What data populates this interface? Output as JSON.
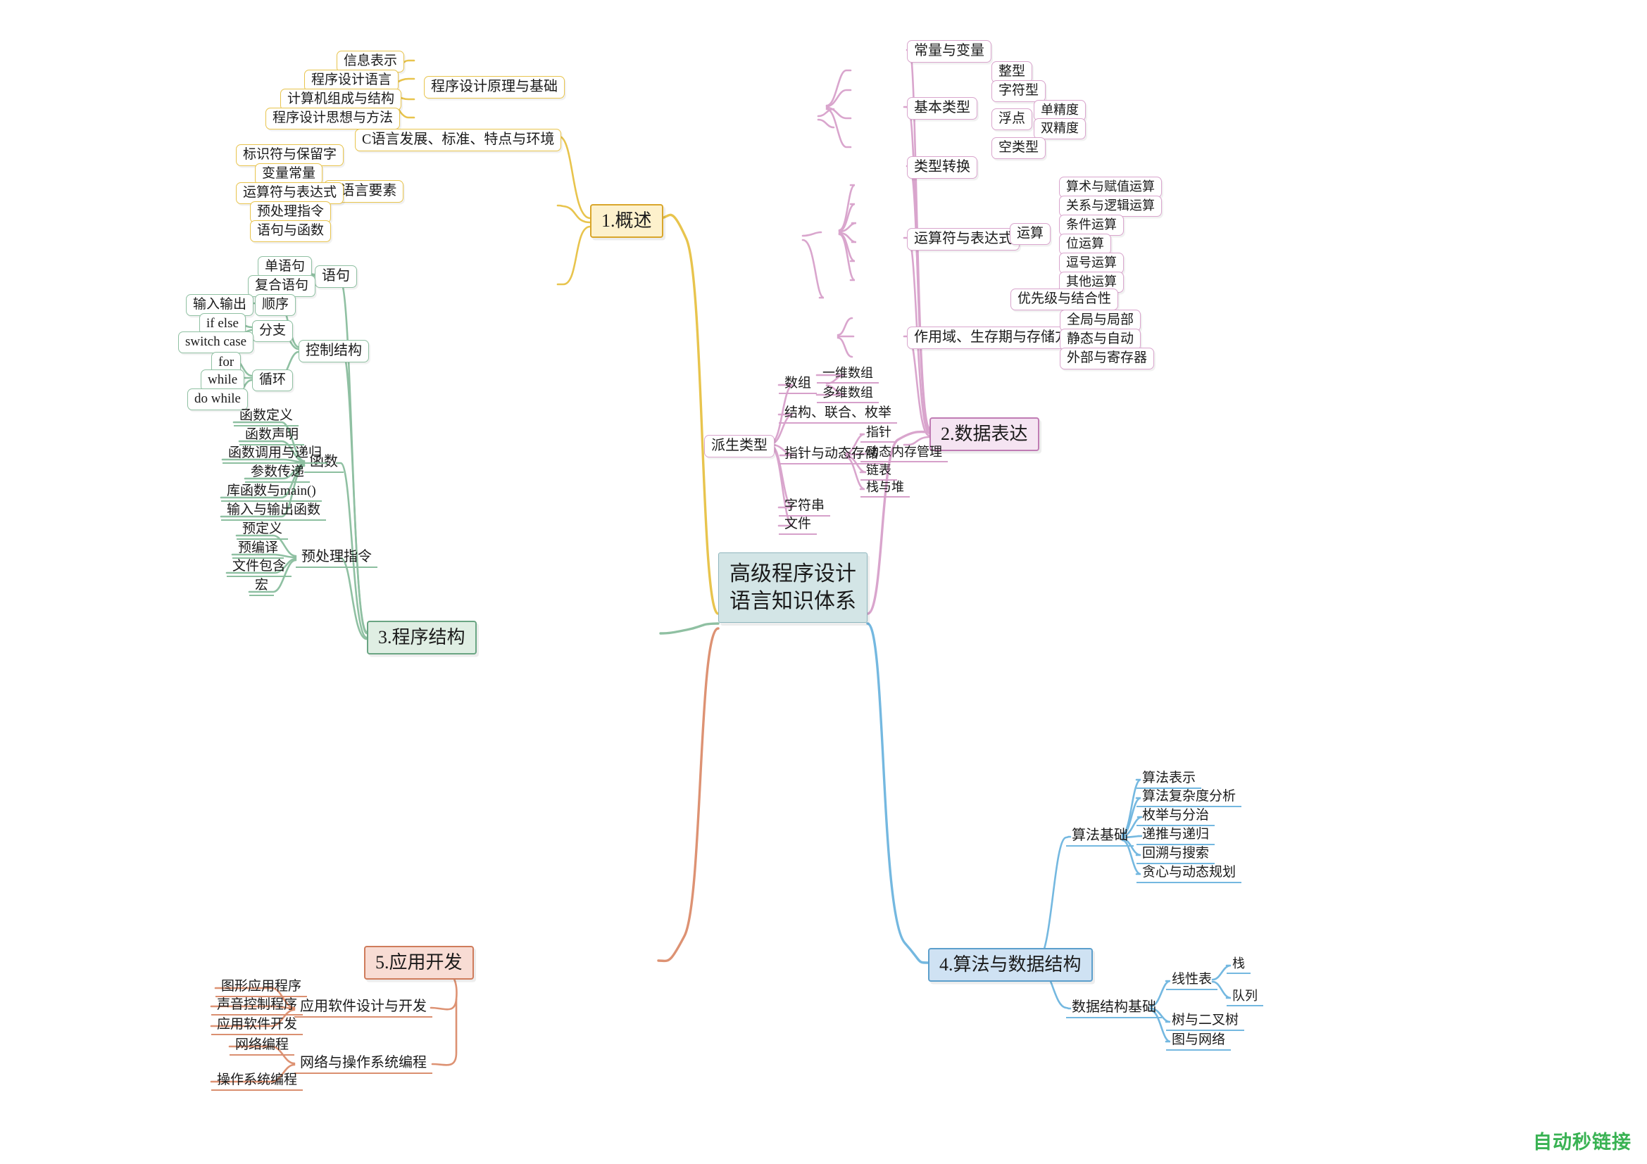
{
  "diagram": {
    "type": "mindmap",
    "root": {
      "label": "高级程序设计语言知识体系",
      "line1": "高级程序设计",
      "line2": "语言知识体系",
      "color": "#d3e5e6"
    },
    "watermark": "自动秒链接",
    "branches": [
      {
        "id": "overview",
        "label": "1.概述",
        "color": "#e8c44d",
        "children": [
          {
            "label": "程序设计原理与基础",
            "children": [
              {
                "label": "信息表示"
              },
              {
                "label": "程序设计语言"
              },
              {
                "label": "计算机组成与结构"
              },
              {
                "label": "程序设计思想与方法"
              }
            ]
          },
          {
            "label": "C语言发展、标准、特点与环境",
            "children": []
          },
          {
            "label": "C语言要素",
            "children": [
              {
                "label": "标识符与保留字"
              },
              {
                "label": "变量常量"
              },
              {
                "label": "运算符与表达式"
              },
              {
                "label": "预处理指令"
              },
              {
                "label": "语句与函数"
              }
            ]
          }
        ]
      },
      {
        "id": "data-expression",
        "label": "2.数据表达",
        "color": "#d9a5cd",
        "children": [
          {
            "label": "常量与变量",
            "children": []
          },
          {
            "label": "基本类型",
            "children": [
              {
                "label": "整型"
              },
              {
                "label": "字符型"
              },
              {
                "label": "浮点",
                "children": [
                  {
                    "label": "单精度"
                  },
                  {
                    "label": "双精度"
                  }
                ]
              },
              {
                "label": "空类型"
              }
            ]
          },
          {
            "label": "类型转换",
            "children": []
          },
          {
            "label": "运算符与表达式",
            "children": [
              {
                "label": "运算",
                "children": [
                  {
                    "label": "算术与赋值运算"
                  },
                  {
                    "label": "关系与逻辑运算"
                  },
                  {
                    "label": "条件运算"
                  },
                  {
                    "label": "位运算"
                  },
                  {
                    "label": "逗号运算"
                  },
                  {
                    "label": "其他运算"
                  }
                ]
              },
              {
                "label": "优先级与结合性"
              }
            ]
          },
          {
            "label": "作用域、生存期与存储方式",
            "children": [
              {
                "label": "全局与局部"
              },
              {
                "label": "静态与自动"
              },
              {
                "label": "外部与寄存器"
              }
            ]
          },
          {
            "label": "派生类型",
            "children": [
              {
                "label": "数组",
                "children": [
                  {
                    "label": "一维数组"
                  },
                  {
                    "label": "多维数组"
                  }
                ]
              },
              {
                "label": "结构、联合、枚举"
              },
              {
                "label": "指针与动态存储",
                "children": [
                  {
                    "label": "指针"
                  },
                  {
                    "label": "动态内存管理"
                  },
                  {
                    "label": "链表"
                  },
                  {
                    "label": "栈与堆"
                  }
                ]
              },
              {
                "label": "字符串"
              },
              {
                "label": "文件"
              }
            ]
          }
        ]
      },
      {
        "id": "program-structure",
        "label": "3.程序结构",
        "color": "#8fc0a2",
        "children": [
          {
            "label": "语句",
            "children": [
              {
                "label": "单语句"
              },
              {
                "label": "复合语句"
              }
            ]
          },
          {
            "label": "控制结构",
            "children": [
              {
                "label": "顺序",
                "children": [
                  {
                    "label": "输入输出"
                  }
                ]
              },
              {
                "label": "分支",
                "children": [
                  {
                    "label": "if else"
                  },
                  {
                    "label": "switch case"
                  }
                ]
              },
              {
                "label": "循环",
                "children": [
                  {
                    "label": "for"
                  },
                  {
                    "label": "while"
                  },
                  {
                    "label": "do while"
                  }
                ]
              }
            ]
          },
          {
            "label": "函数",
            "children": [
              {
                "label": "函数定义"
              },
              {
                "label": "函数声明"
              },
              {
                "label": "函数调用与递归"
              },
              {
                "label": "参数传递"
              },
              {
                "label": "库函数与main()"
              },
              {
                "label": "输入与输出函数"
              }
            ]
          },
          {
            "label": "预处理指令",
            "children": [
              {
                "label": "预定义"
              },
              {
                "label": "预编译"
              },
              {
                "label": "文件包含"
              },
              {
                "label": "宏"
              }
            ]
          }
        ]
      },
      {
        "id": "algorithms",
        "label": "4.算法与数据结构",
        "color": "#74b8e0",
        "children": [
          {
            "label": "算法基础",
            "children": [
              {
                "label": "算法表示"
              },
              {
                "label": "算法复杂度分析"
              },
              {
                "label": "枚举与分治"
              },
              {
                "label": "递推与递归"
              },
              {
                "label": "回溯与搜索"
              },
              {
                "label": "贪心与动态规划"
              }
            ]
          },
          {
            "label": "数据结构基础",
            "children": [
              {
                "label": "线性表",
                "children": [
                  {
                    "label": "栈"
                  },
                  {
                    "label": "队列"
                  }
                ]
              },
              {
                "label": "树与二叉树"
              },
              {
                "label": "图与网络"
              }
            ]
          }
        ]
      },
      {
        "id": "application",
        "label": "5.应用开发",
        "color": "#dd9273",
        "children": [
          {
            "label": "应用软件设计与开发",
            "children": [
              {
                "label": "图形应用程序"
              },
              {
                "label": "声音控制程序"
              },
              {
                "label": "应用软件开发"
              }
            ]
          },
          {
            "label": "网络与操作系统编程",
            "children": [
              {
                "label": "网络编程"
              },
              {
                "label": "操作系统编程"
              }
            ]
          }
        ]
      }
    ]
  }
}
